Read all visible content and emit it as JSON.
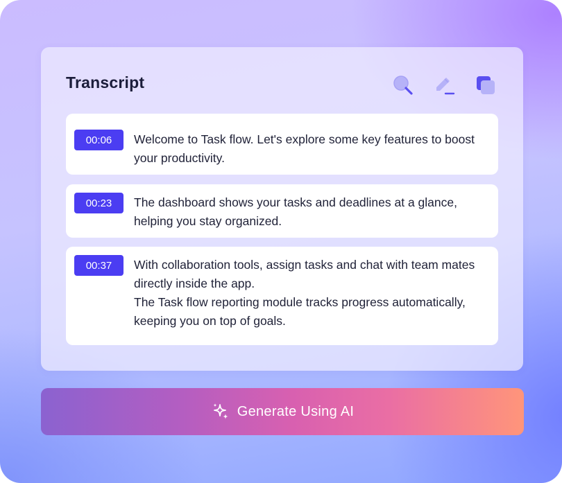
{
  "transcript": {
    "title": "Transcript",
    "tools": [
      {
        "icon": "search-icon"
      },
      {
        "icon": "edit-pencil-icon"
      },
      {
        "icon": "copy-icon"
      }
    ],
    "entries": [
      {
        "time": "00:06",
        "lines": [
          "Welcome to Task flow. Let's explore some key features to boost",
          "your productivity."
        ]
      },
      {
        "time": "00:23",
        "lines": [
          "The dashboard shows your tasks and deadlines at a glance,",
          "helping you stay organized."
        ]
      },
      {
        "time": "00:37",
        "lines": [
          "With collaboration tools, assign tasks and chat with team mates",
          "directly inside the app.",
          "The Task flow reporting module tracks progress automatically,",
          "keeping you on top of goals."
        ]
      }
    ]
  },
  "action": {
    "label": "Generate Using AI",
    "icon": "sparkles-icon"
  },
  "colors": {
    "accent": "#4b3df2",
    "icon_light": "#a9a6f7",
    "icon_dark": "#5a4ff0",
    "text": "#1f2137"
  }
}
